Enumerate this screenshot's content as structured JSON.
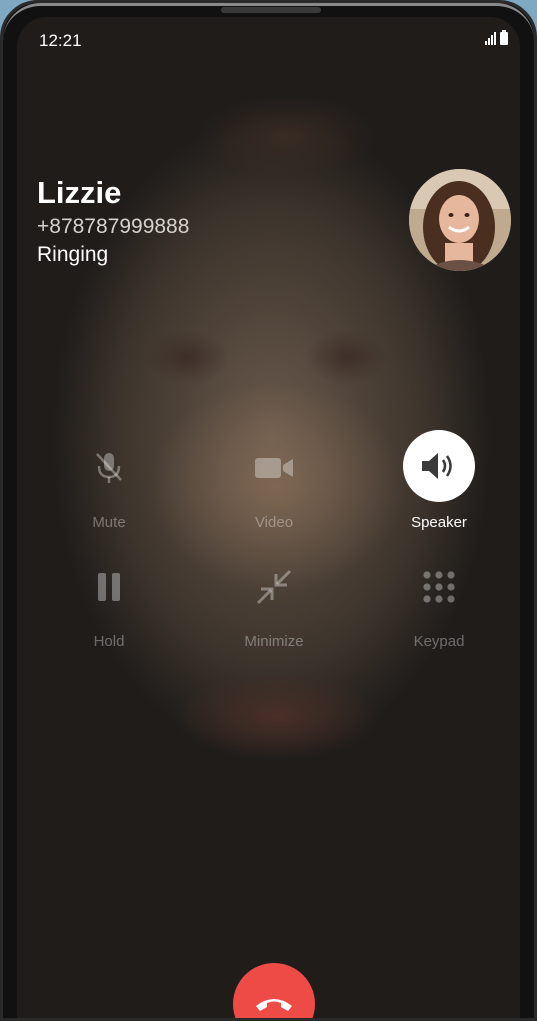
{
  "status_bar": {
    "time": "12:21"
  },
  "caller": {
    "name": "Lizzie",
    "number": "+878787999888",
    "status": "Ringing"
  },
  "controls": [
    {
      "label": "Mute",
      "icon": "mic-off-icon",
      "active": false
    },
    {
      "label": "Video",
      "icon": "video-icon",
      "active": false
    },
    {
      "label": "Speaker",
      "icon": "speaker-icon",
      "active": true
    },
    {
      "label": "Hold",
      "icon": "pause-icon",
      "active": false
    },
    {
      "label": "Minimize",
      "icon": "minimize-icon",
      "active": false
    },
    {
      "label": "Keypad",
      "icon": "keypad-icon",
      "active": false
    }
  ],
  "colors": {
    "end_call": "#ee4b46",
    "active_button_bg": "#ffffff"
  }
}
